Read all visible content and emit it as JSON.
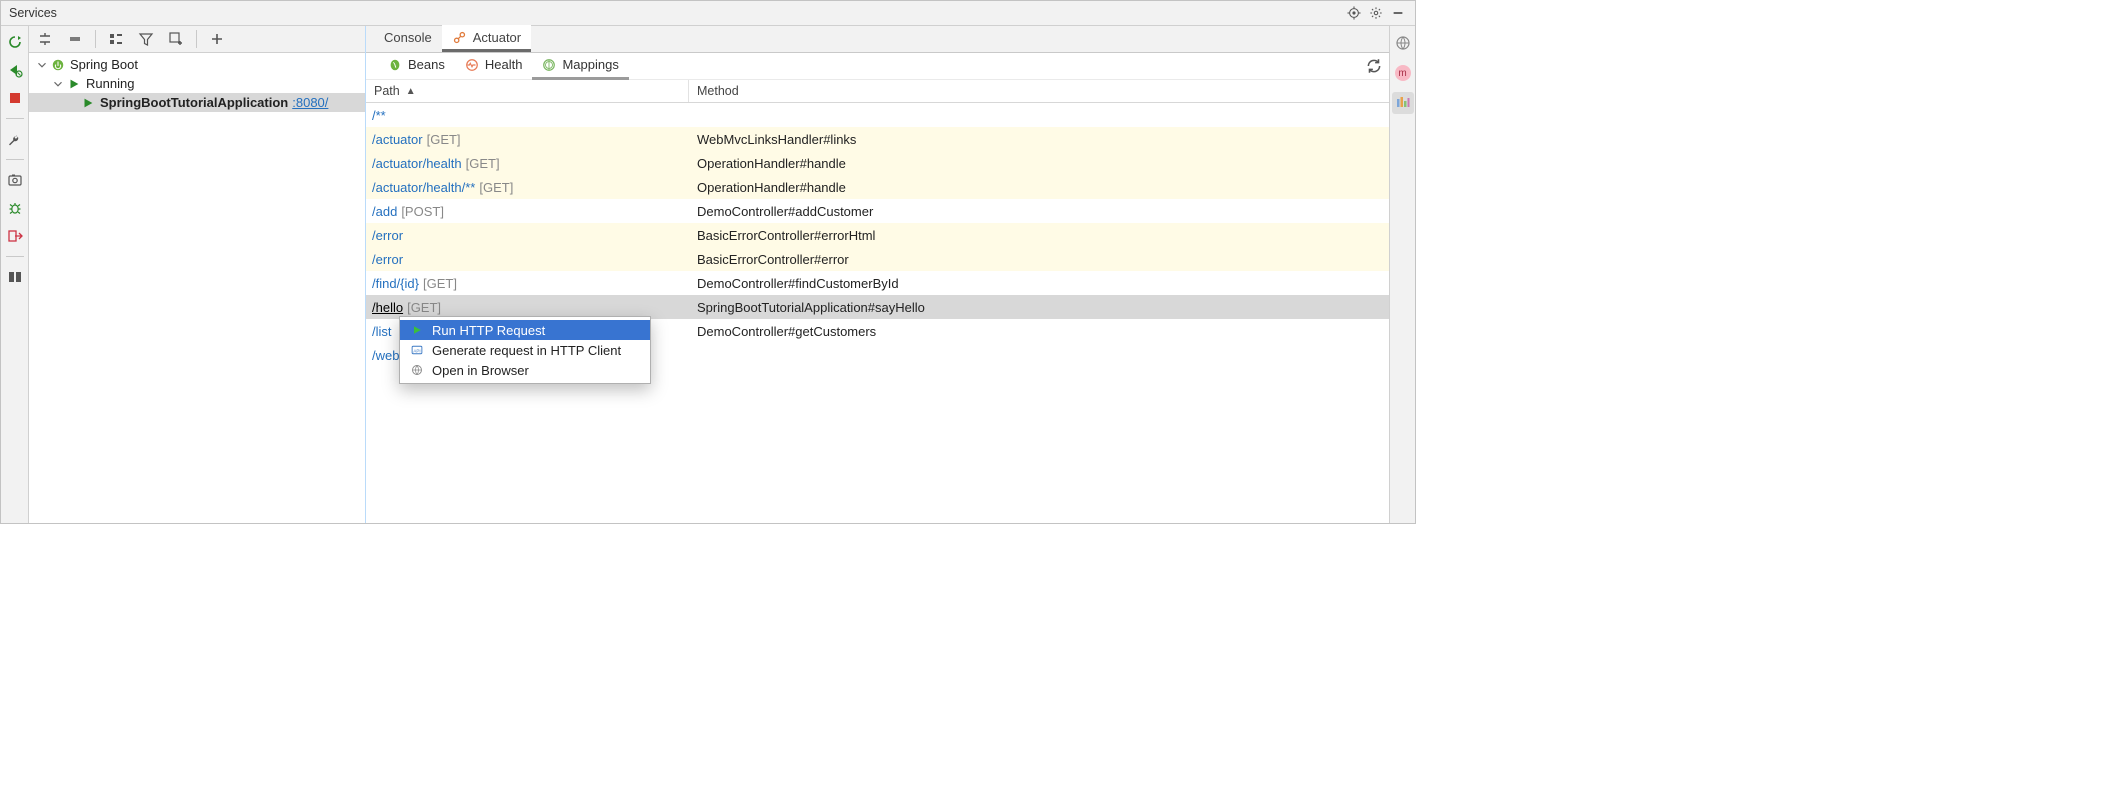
{
  "title": "Services",
  "tree": {
    "root": {
      "label": "Spring Boot"
    },
    "running": {
      "label": "Running"
    },
    "app": {
      "label": "SpringBootTutorialApplication",
      "port": ":8080/"
    }
  },
  "main_tabs": {
    "console": "Console",
    "actuator": "Actuator"
  },
  "sub_tabs": {
    "beans": "Beans",
    "health": "Health",
    "mappings": "Mappings"
  },
  "table": {
    "header": {
      "path": "Path",
      "method": "Method"
    },
    "rows": [
      {
        "path": "/**",
        "http": "",
        "method": "",
        "alt": false
      },
      {
        "path": "/actuator",
        "http": "[GET]",
        "method": "WebMvcLinksHandler#links",
        "alt": true
      },
      {
        "path": "/actuator/health",
        "http": "[GET]",
        "method": "OperationHandler#handle",
        "alt": true
      },
      {
        "path": "/actuator/health/**",
        "http": "[GET]",
        "method": "OperationHandler#handle",
        "alt": true
      },
      {
        "path": "/add",
        "http": "[POST]",
        "method": "DemoController#addCustomer",
        "alt": false
      },
      {
        "path": "/error",
        "http": "",
        "method": "BasicErrorController#errorHtml",
        "alt": true
      },
      {
        "path": "/error",
        "http": "",
        "method": "BasicErrorController#error",
        "alt": true
      },
      {
        "path": "/find/{id}",
        "http": "[GET]",
        "method": "DemoController#findCustomerById",
        "alt": false
      },
      {
        "path": "/hello",
        "http": "[GET]",
        "method": "SpringBootTutorialApplication#sayHello",
        "selected": true
      },
      {
        "path": "/list",
        "http": "",
        "method": "DemoController#getCustomers",
        "alt": false
      },
      {
        "path": "/web",
        "http": "",
        "method": "",
        "alt": false
      }
    ]
  },
  "context_menu": {
    "run": "Run HTTP Request",
    "generate": "Generate request in HTTP Client",
    "open": "Open in Browser"
  },
  "right_badge": "m"
}
